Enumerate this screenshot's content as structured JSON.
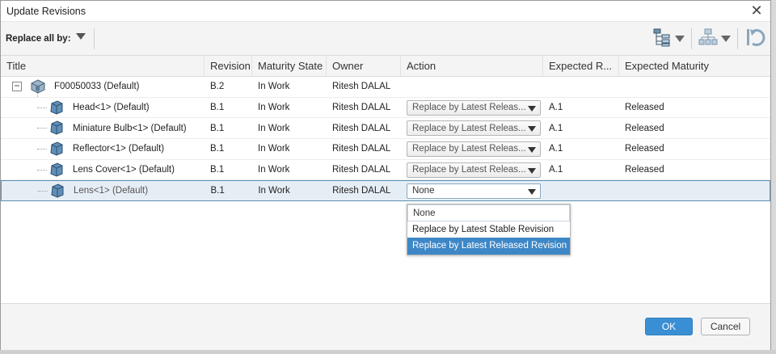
{
  "window": {
    "title": "Update Revisions",
    "close_icon": "close-icon"
  },
  "toolbar": {
    "replace_all_label": "Replace all by:",
    "icons": [
      "tree-view-icon",
      "hierarchy-icon",
      "undo-icon"
    ]
  },
  "columns": [
    "Title",
    "Revision",
    "Maturity State",
    "Owner",
    "Action",
    "Expected R...",
    "Expected Maturity"
  ],
  "rows": [
    {
      "title": "F00050033 (Default)",
      "revision": "B.2",
      "maturity": "In Work",
      "owner": "Ritesh DALAL",
      "action": "",
      "expected_revision": "",
      "expected_maturity": ""
    },
    {
      "title": "Head<1> (Default)",
      "revision": "B.1",
      "maturity": "In Work",
      "owner": "Ritesh DALAL",
      "action": "Replace by Latest Releas...",
      "expected_revision": "A.1",
      "expected_maturity": "Released"
    },
    {
      "title": "Miniature Bulb<1> (Default)",
      "revision": "B.1",
      "maturity": "In Work",
      "owner": "Ritesh DALAL",
      "action": "Replace by Latest Releas...",
      "expected_revision": "A.1",
      "expected_maturity": "Released"
    },
    {
      "title": "Reflector<1> (Default)",
      "revision": "B.1",
      "maturity": "In Work",
      "owner": "Ritesh DALAL",
      "action": "Replace by Latest Releas...",
      "expected_revision": "A.1",
      "expected_maturity": "Released"
    },
    {
      "title": "Lens Cover<1> (Default)",
      "revision": "B.1",
      "maturity": "In Work",
      "owner": "Ritesh DALAL",
      "action": "Replace by Latest Releas...",
      "expected_revision": "A.1",
      "expected_maturity": "Released"
    },
    {
      "title": "Lens<1> (Default)",
      "revision": "B.1",
      "maturity": "In Work",
      "owner": "Ritesh DALAL",
      "action": "None",
      "expected_revision": "",
      "expected_maturity": ""
    }
  ],
  "dropdown": {
    "options": [
      "None",
      "Replace by Latest Stable Revision",
      "Replace by Latest Released Revision"
    ],
    "highlighted": "Replace by Latest Released Revision"
  },
  "footer": {
    "ok_label": "OK",
    "cancel_label": "Cancel"
  },
  "colors": {
    "accent": "#3a8fd4",
    "selection_border": "#5c8fb3",
    "highlight": "#3d87c7"
  }
}
